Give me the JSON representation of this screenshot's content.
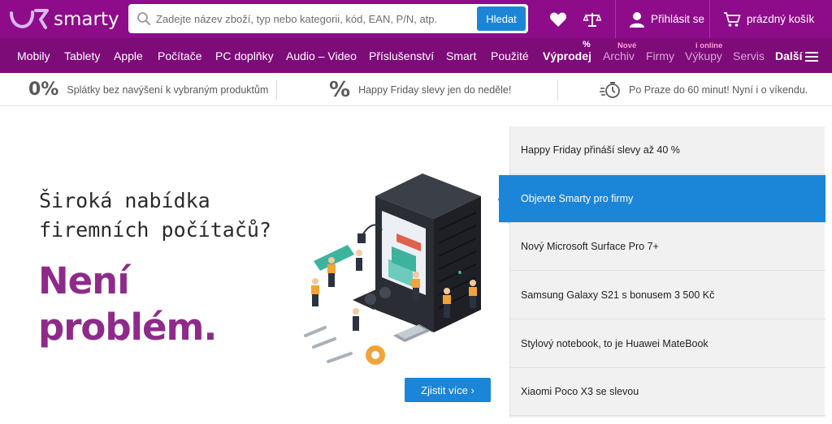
{
  "header": {
    "logo_text": "smarty",
    "search_placeholder": "Zadejte název zboží, typ nebo kategorii, kód, EAN, P/N, atp.",
    "search_button": "Hledat",
    "login_label": "Přihlásit se",
    "cart_label": "prázdný košík",
    "icons": [
      "heart-icon",
      "scales-icon",
      "user-icon",
      "cart-icon",
      "search-icon"
    ]
  },
  "nav": {
    "items": [
      {
        "label": "Mobily"
      },
      {
        "label": "Tablety"
      },
      {
        "label": "Apple"
      },
      {
        "label": "Počítače"
      },
      {
        "label": "PC doplňky"
      },
      {
        "label": "Audio – Video"
      },
      {
        "label": "Příslušenství"
      },
      {
        "label": "Smart"
      },
      {
        "label": "Použité"
      },
      {
        "label": "Výprodej",
        "badge": "%"
      },
      {
        "label": "Archiv",
        "badge": "Nové"
      },
      {
        "label": "Firmy"
      },
      {
        "label": "Výkupy",
        "badge": "i online"
      },
      {
        "label": "Servis"
      },
      {
        "label": "Další"
      }
    ]
  },
  "strip": {
    "items": [
      {
        "icon_text": "0%",
        "text": "Splátky bez navýšení k vybraným produktům"
      },
      {
        "icon_text": "%",
        "text": "Happy Friday slevy jen do neděle!"
      },
      {
        "icon": "fast-delivery-icon",
        "text": "Po Praze do 60 minut! Nyní i o víkendu."
      }
    ]
  },
  "hero": {
    "line1": "Široká nabídka",
    "line2": "firemních počítačů?",
    "big1": "Není",
    "big2": "problém.",
    "cta": "Zjistit více ›"
  },
  "side": {
    "items": [
      {
        "label": "Happy Friday přináší slevy až 40 %",
        "active": false
      },
      {
        "label": "Objevte Smarty pro firmy",
        "active": true
      },
      {
        "label": "Nový Microsoft Surface Pro 7+",
        "active": false
      },
      {
        "label": "Samsung Galaxy S21 s bonusem 3 500 Kč",
        "active": false
      },
      {
        "label": "Stylový notebook, to je Huawei MateBook",
        "active": false
      },
      {
        "label": "Xiaomi Poco X3 se slevou",
        "active": false
      }
    ]
  },
  "colors": {
    "header_bg": "#8e0b8a",
    "nav_bg": "#7d0c79",
    "accent_blue": "#1b85d8",
    "hero_purple": "#8e2b8a"
  }
}
